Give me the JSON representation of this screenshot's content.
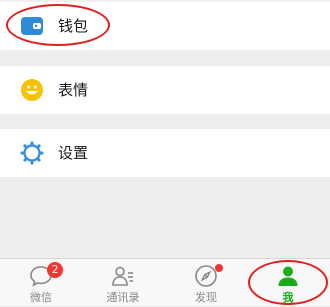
{
  "menu": {
    "wallet": {
      "label": "钱包",
      "icon": "wallet-icon"
    },
    "emoji": {
      "label": "表情",
      "icon": "smiley-icon"
    },
    "settings": {
      "label": "设置",
      "icon": "gear-icon"
    }
  },
  "tabbar": {
    "tabs": [
      {
        "label": "微信",
        "icon": "chat-bubble-icon",
        "badge": "2"
      },
      {
        "label": "通讯录",
        "icon": "contacts-icon"
      },
      {
        "label": "发现",
        "icon": "compass-icon"
      },
      {
        "label": "我",
        "icon": "person-icon"
      }
    ],
    "active": "我"
  },
  "colors": {
    "accent": "#1aad19",
    "wallet_icon": "#2f8bd6",
    "emoji_icon": "#f6c300",
    "settings_icon": "#3a8ee6",
    "badge": "#f43530",
    "annotation": "#e02020"
  }
}
